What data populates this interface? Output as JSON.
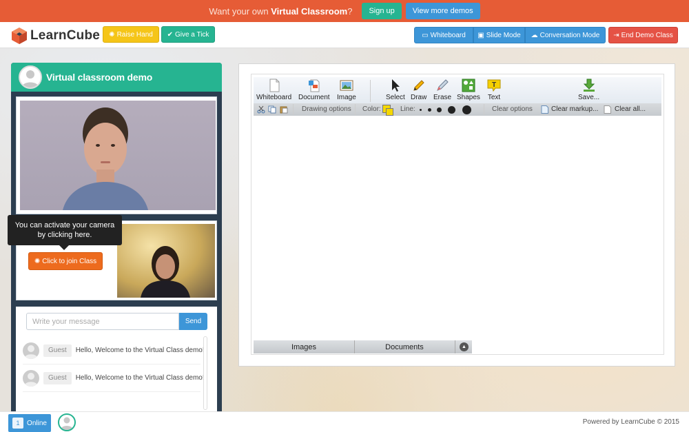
{
  "promo": {
    "text_prefix": "Want your own ",
    "text_bold": "Virtual Classroom",
    "text_suffix": "?",
    "signup_label": "Sign up",
    "more_demos_label": "View more demos"
  },
  "nav": {
    "logo_text": "LearnCube",
    "raise_hand_label": "Raise Hand",
    "give_tick_label": "Give a Tick",
    "whiteboard_label": "Whiteboard",
    "slide_mode_label": "Slide Mode",
    "conversation_mode_label": "Conversation Mode",
    "end_demo_label": "End Demo Class"
  },
  "left_panel": {
    "title": "Virtual classroom demo",
    "tooltip": "You can activate your camera by clicking here.",
    "join_label": "Click to join Class"
  },
  "chat": {
    "placeholder": "Write your message",
    "send_label": "Send",
    "messages": [
      {
        "author": "Guest",
        "text": "Hello, Welcome to the Virtual Class demo!"
      },
      {
        "author": "Guest",
        "text": "Hello, Welcome to the Virtual Class demo!"
      }
    ]
  },
  "whiteboard": {
    "tools": [
      "Whiteboard",
      "Document",
      "Image",
      "Select",
      "Draw",
      "Erase",
      "Shapes",
      "Text",
      "Save..."
    ],
    "options": {
      "drawing_options": "Drawing options",
      "color_label": "Color:",
      "color_value": "#f5d800",
      "line_label": "Line:",
      "clear_options": "Clear options",
      "clear_markup": "Clear markup...",
      "clear_all": "Clear all..."
    },
    "bottom_tabs": [
      "Images",
      "Documents"
    ]
  },
  "footer": {
    "online_count": "1",
    "online_label": "Online",
    "powered_by": "Powered by LearnCube © 2015"
  },
  "colors": {
    "promo_orange": "#e65c36",
    "teal": "#26b491",
    "blue": "#3d96d8",
    "yellow": "#f5c518",
    "red": "#e55245",
    "navy": "#2c3e50"
  }
}
